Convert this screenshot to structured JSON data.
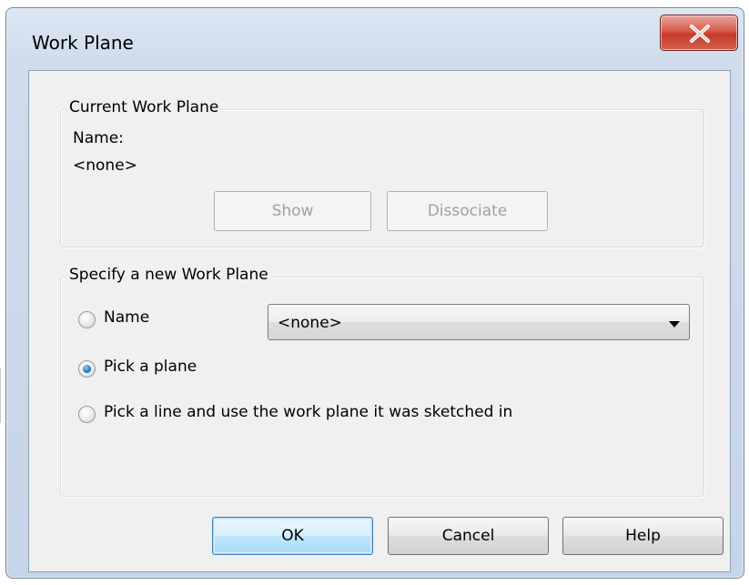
{
  "window": {
    "title": "Work Plane",
    "close_glyph": "x"
  },
  "current": {
    "group_label": "Current Work Plane",
    "name_label": "Name:",
    "name_value": "<none>",
    "show_button": "Show",
    "dissociate_button": "Dissociate"
  },
  "new_plane": {
    "group_label": "Specify a new Work Plane",
    "options": [
      {
        "label": "Name",
        "selected": false
      },
      {
        "label": "Pick a plane",
        "selected": true
      },
      {
        "label": "Pick a line and use the work plane it was sketched in",
        "selected": false
      }
    ],
    "name_select_value": "<none>"
  },
  "footer": {
    "ok": "OK",
    "cancel": "Cancel",
    "help": "Help"
  },
  "colors": {
    "title_bar": "#cfdcec",
    "close_button": "#c53a2a",
    "dialog_bg": "#f0f0f0",
    "default_button_border": "#3c7fb1"
  }
}
